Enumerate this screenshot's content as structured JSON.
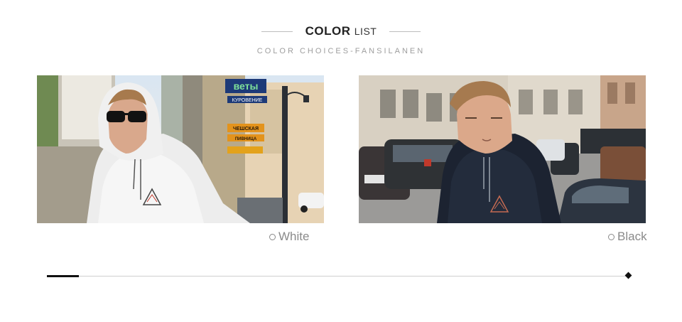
{
  "header": {
    "title_strong": "COLOR",
    "title_light": "LIST",
    "subtitle": "COLOR CHOICES-FANSILANEN"
  },
  "photos": [
    {
      "color_name": "White",
      "signs": [
        "веты",
        "КУРОВЕНИЕ",
        "ЧЕШСКАЯ",
        "ПИВНИЦА"
      ]
    },
    {
      "color_name": "Black"
    }
  ],
  "progress": {
    "value": 0.055
  },
  "colors": {
    "accent": "#111111",
    "line": "#cfcfcf",
    "label": "#8a8a8a"
  }
}
